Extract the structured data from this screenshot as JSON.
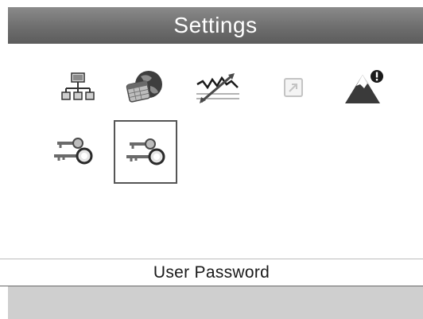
{
  "header": {
    "title": "Settings"
  },
  "icons": [
    {
      "name": "network-icon",
      "selected": false,
      "enabled": true
    },
    {
      "name": "globe-calendar-icon",
      "selected": false,
      "enabled": true
    },
    {
      "name": "signal-trend-icon",
      "selected": false,
      "enabled": true
    },
    {
      "name": "external-link-icon",
      "selected": false,
      "enabled": false
    },
    {
      "name": "mountain-alert-icon",
      "selected": false,
      "enabled": true
    },
    {
      "name": "admin-password-icon",
      "selected": false,
      "enabled": true
    },
    {
      "name": "user-password-icon",
      "selected": true,
      "enabled": true
    }
  ],
  "status": {
    "label": "User Password"
  }
}
